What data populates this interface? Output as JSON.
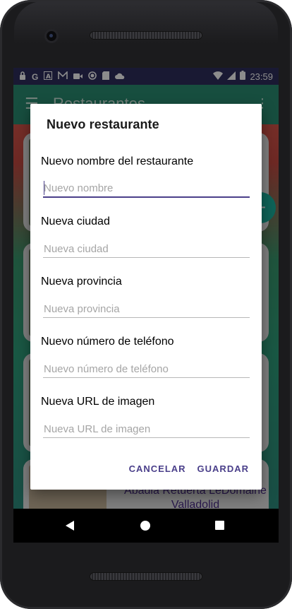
{
  "status_bar": {
    "time": "23:59",
    "left_icons": [
      "lock-icon",
      "google-icon",
      "a-icon",
      "mail-icon",
      "video-icon",
      "circle-icon",
      "sd-card-icon",
      "cloud-icon"
    ],
    "right_icons": [
      "wifi-icon",
      "signal-icon",
      "battery-icon"
    ]
  },
  "app_bar": {
    "title": "Restaurantes",
    "menu_icon": "menu-icon",
    "overflow_icon": "more-vert-icon"
  },
  "background_list": {
    "visible_card_text_line1": "Abadia Retuerta LeDomaine",
    "visible_card_text_line2": "Valladolid"
  },
  "dialog": {
    "title": "Nuevo restaurante",
    "fields": [
      {
        "label": "Nuevo nombre del restaurante",
        "placeholder": "Nuevo nombre",
        "value": ""
      },
      {
        "label": "Nueva ciudad",
        "placeholder": "Nueva ciudad",
        "value": ""
      },
      {
        "label": "Nueva provincia",
        "placeholder": "Nueva provincia",
        "value": ""
      },
      {
        "label": "Nuevo número de teléfono",
        "placeholder": "Nuevo número de teléfono",
        "value": ""
      },
      {
        "label": "Nueva URL de imagen",
        "placeholder": "Nueva URL de imagen",
        "value": ""
      }
    ],
    "cancel_label": "CANCELAR",
    "save_label": "GUARDAR"
  },
  "colors": {
    "accent": "#4a3f8a",
    "status_bar": "#2e2f5e",
    "app_bar": "#2a8f74"
  }
}
